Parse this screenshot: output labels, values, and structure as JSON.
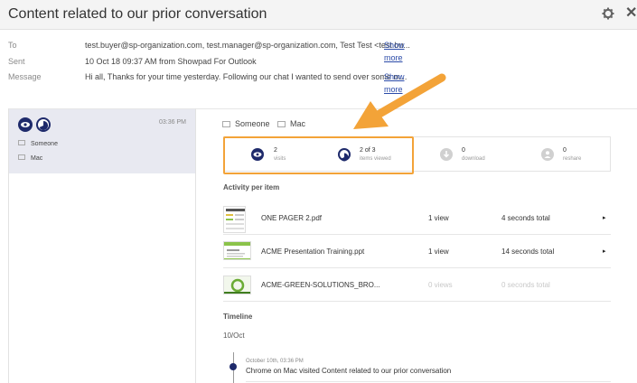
{
  "header": {
    "title": "Content related to our prior conversation"
  },
  "meta": {
    "to": {
      "label": "To",
      "value": "test.buyer@sp-organization.com, test.manager@sp-organization.com, Test Test <test.bu...",
      "more": "Show more"
    },
    "sent": {
      "label": "Sent",
      "value": "10 Oct 18 09:37 AM from Showpad For Outlook"
    },
    "message": {
      "label": "Message",
      "value": "Hi all, Thanks for your time yesterday. Following our chat I wanted to send over some m...",
      "more": "Show more"
    }
  },
  "session": {
    "time": "03:36 PM",
    "person": "Someone",
    "device": "Mac"
  },
  "detail": {
    "person": "Someone",
    "device": "Mac"
  },
  "stats": [
    {
      "value": "2",
      "label": "visits",
      "icon": "eye-icon"
    },
    {
      "value": "2 of 3",
      "label": "items viewed",
      "icon": "document-icon"
    },
    {
      "value": "0",
      "label": "download",
      "icon": "download-icon"
    },
    {
      "value": "0",
      "label": "reshare",
      "icon": "reshare-icon"
    }
  ],
  "activity": {
    "title": "Activity per item",
    "items": [
      {
        "name": "ONE PAGER 2.pdf",
        "views": "1 view",
        "time": "4 seconds total",
        "arrow": "▸"
      },
      {
        "name": "ACME Presentation Training.ppt",
        "views": "1 view",
        "time": "14 seconds total",
        "arrow": "▸"
      },
      {
        "name": "ACME-GREEN-SOLUTIONS_BRO...",
        "views": "0 views",
        "time": "0 seconds total"
      }
    ]
  },
  "timeline": {
    "title": "Timeline",
    "date": "10/Oct",
    "entry_time": "October 10th, 03:36 PM",
    "entry_text": "Chrome on Mac visited Content related to our prior conversation"
  },
  "colors": {
    "accent": "#1e2a6b",
    "highlight": "#f3a338",
    "link": "#2a4aa8"
  }
}
